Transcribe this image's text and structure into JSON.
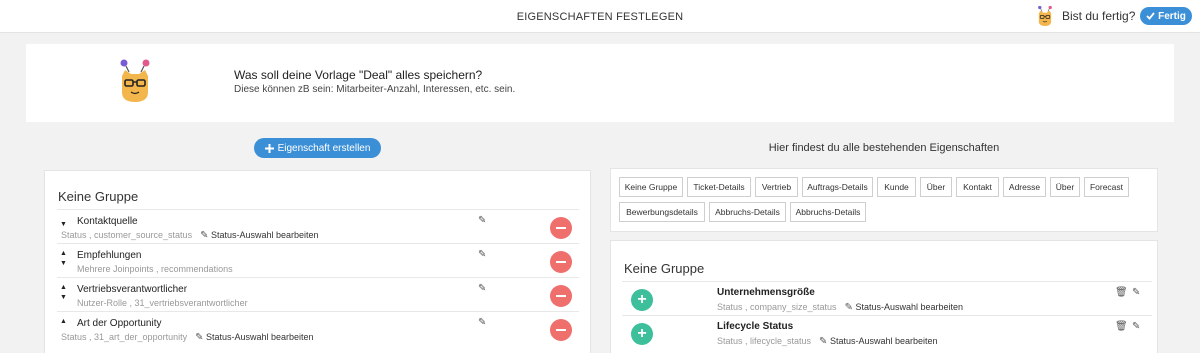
{
  "header": {
    "title": "EIGENSCHAFTEN FESTLEGEN",
    "ready_text": "Bist du fertig?",
    "done_label": "Fertig",
    "done_icon": "check-icon"
  },
  "intro": {
    "question": "Was soll deine Vorlage \"Deal\" alles speichern?",
    "subtext": "Diese können zB sein: Mitarbeiter-Anzahl, Interessen, etc. sein."
  },
  "actions": {
    "create_label": "Eigenschaft erstellen"
  },
  "left": {
    "group_title": "Keine Gruppe",
    "rows": [
      {
        "name": "Kontaktquelle",
        "meta": "Status , customer_source_status",
        "edit": "Status-Auswahl bearbeiten"
      },
      {
        "name": "Empfehlungen",
        "meta": "Mehrere Joinpoints , recommendations",
        "edit": ""
      },
      {
        "name": "Vertriebsverantwortlicher",
        "meta": "Nutzer-Rolle , 31_vertriebsverantwortlicher",
        "edit": ""
      },
      {
        "name": "Art der Opportunity",
        "meta": "Status , 31_art_der_opportunity",
        "edit": "Status-Auswahl bearbeiten"
      }
    ]
  },
  "right": {
    "heading": "Hier findest du alle bestehenden Eigenschaften",
    "chips": [
      "Keine Gruppe",
      "Ticket-Details",
      "Vertrieb",
      "Auftrags-Details",
      "Kunde",
      "Über",
      "Kontakt",
      "Adresse",
      "Über",
      "Forecast",
      "Bewerbungsdetails",
      "Abbruchs-Details",
      "Abbruchs-Details"
    ],
    "group_title": "Keine Gruppe",
    "rows": [
      {
        "name": "Unternehmensgröße",
        "meta": "Status , company_size_status",
        "edit": "Status-Auswahl bearbeiten"
      },
      {
        "name": "Lifecycle Status",
        "meta": "Status , lifecycle_status",
        "edit": "Status-Auswahl bearbeiten"
      }
    ]
  },
  "colors": {
    "primary": "#3b8fd6",
    "danger": "#ef6f6c",
    "success": "#3dbf9b"
  }
}
